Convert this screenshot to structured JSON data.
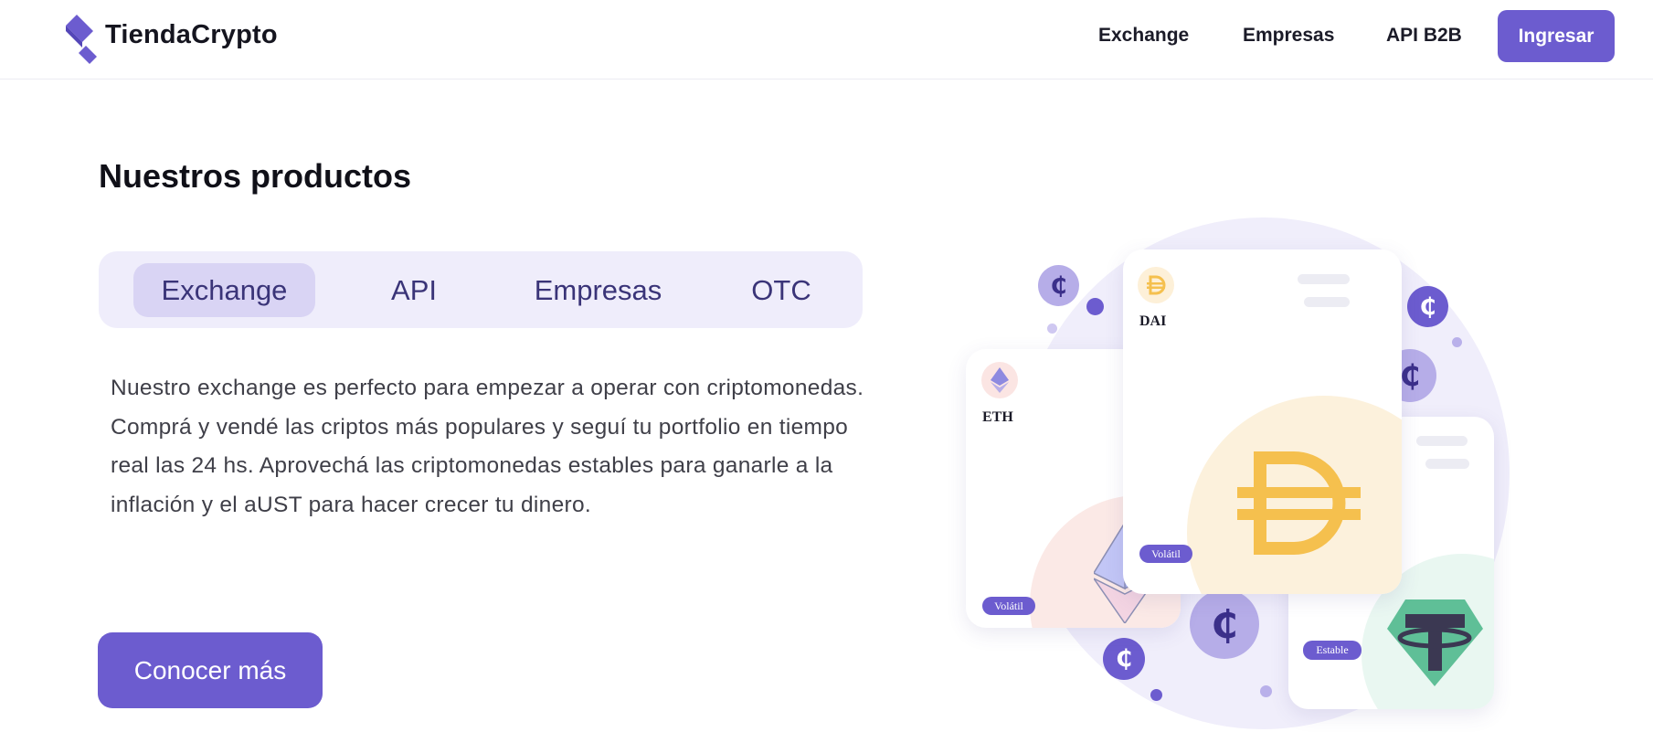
{
  "header": {
    "brand": "TiendaCrypto",
    "nav": [
      "Exchange",
      "Empresas",
      "API B2B"
    ],
    "login_label": "Ingresar"
  },
  "main": {
    "title": "Nuestros productos",
    "tabs": [
      {
        "label": "Exchange",
        "active": true
      },
      {
        "label": "API",
        "active": false
      },
      {
        "label": "Empresas",
        "active": false
      },
      {
        "label": "OTC",
        "active": false
      }
    ],
    "description": "Nuestro exchange es perfecto para empezar a operar con criptomonedas. Comprá y vendé las criptos más populares y seguí tu portfolio en tiempo real las 24 hs. Aprovechá las criptomonedas estables para ganarle a la inflación y el aUST para hacer crecer tu dinero.",
    "cta_label": "Conocer más"
  },
  "illustration": {
    "coin_symbol": "₵",
    "cards": [
      {
        "symbol": "ETH",
        "tag": "Volátil",
        "icon": "ethereum-icon"
      },
      {
        "symbol": "DAI",
        "tag": "Volátil",
        "icon": "dai-icon"
      },
      {
        "symbol": "",
        "tag": "Estable",
        "icon": "tether-icon"
      }
    ]
  },
  "colors": {
    "accent": "#6c5ccf",
    "tab_bg": "#efedfb",
    "tab_active": "#d9d4f4",
    "dai_yellow": "#f5c04e",
    "tether_green": "#5fbf97"
  }
}
